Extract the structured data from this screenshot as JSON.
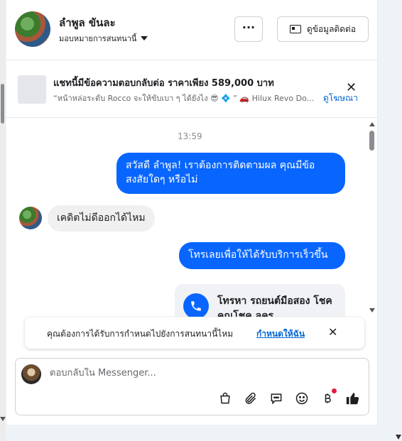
{
  "header": {
    "contact_name": "ลำพูล ขันละ",
    "assign_label": "มอบหมายการสนทนานี้",
    "more_label": "···",
    "contact_info_label": "ดูข้อมูลติดต่อ"
  },
  "ad_banner": {
    "title": "แชทนี้มีข้อความตอบกลับต่อ ราคาเพียง 589,000 บาท",
    "subtitle": "“หน้าหล่อระดับ Rocco จะให้ขับเบา ๆ ได้ยังไง 😎 💠 ” 🚗 Hilux Revo Do...",
    "link_label": "ดูโฆษณา",
    "close_label": "✕"
  },
  "thread": {
    "timestamp": "13:59",
    "messages": [
      {
        "direction": "outgoing",
        "text": "สวัสดี ลำพูล! เราต้องการติดตามผล คุณมีข้อสงสัยใดๆ หรือไม่"
      },
      {
        "direction": "incoming",
        "text": "เคดิตไม่ดีออกได้ไหม"
      },
      {
        "direction": "outgoing",
        "text": "โทรเลยเพื่อให้ได้รับบริการเร็วขึ้น"
      }
    ],
    "call_card_title": "โทรหา รถยนต์มือสอง โชคคูณโชค ลคร"
  },
  "notification": {
    "text": "คุณต้องการได้รับการกำหนดไปยังการสนทนานี้ไหม",
    "link_label": "กำหนดให้ฉัน",
    "close_label": "✕"
  },
  "composer": {
    "placeholder": "ตอบกลับใน Messenger...",
    "value": "",
    "tools": [
      "bag-icon",
      "paperclip-icon",
      "chat-icon",
      "emoji-icon",
      "baht-icon",
      "thumbs-up-icon"
    ]
  },
  "colors": {
    "accent": "#0866ff",
    "link": "#0064d1",
    "incoming_bubble": "#f0f0f0",
    "notification_dot": "#e41e3f"
  }
}
